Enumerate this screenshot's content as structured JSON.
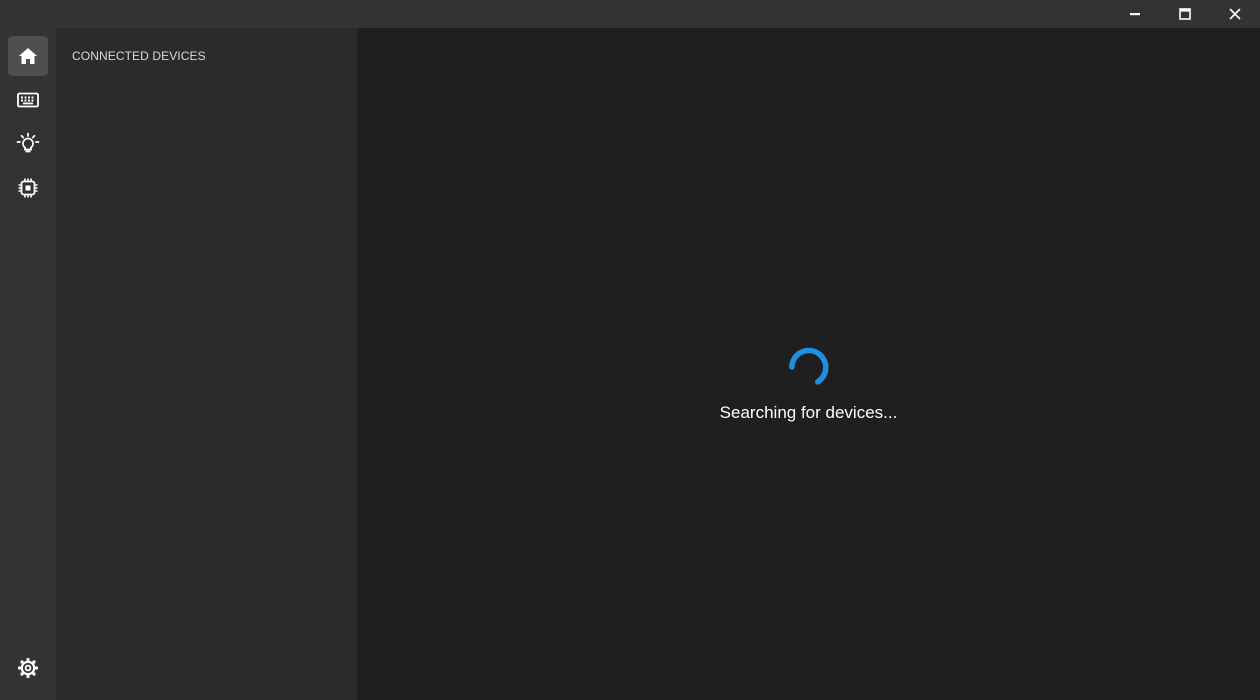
{
  "titlebar": {
    "controls": [
      {
        "name": "minimize",
        "icon": "minimize-icon"
      },
      {
        "name": "maximize",
        "icon": "maximize-icon"
      },
      {
        "name": "close",
        "icon": "close-icon"
      }
    ]
  },
  "rail": {
    "items": [
      {
        "id": "home",
        "icon": "home-icon",
        "active": true
      },
      {
        "id": "keyboard",
        "icon": "keyboard-icon",
        "active": false
      },
      {
        "id": "lighting",
        "icon": "lightbulb-icon",
        "active": false
      },
      {
        "id": "device",
        "icon": "chip-icon",
        "active": false
      }
    ],
    "settings": {
      "icon": "gear-icon"
    }
  },
  "side_panel": {
    "header": "CONNECTED DEVICES"
  },
  "main": {
    "status_text": "Searching for devices...",
    "spinner_color": "#1e8fe1"
  },
  "colors": {
    "titlebar_bg": "#333333",
    "rail_bg": "#333333",
    "rail_active_bg": "#4f4f4f",
    "side_panel_bg": "#2b2b2b",
    "content_bg": "#1f1f1f",
    "accent": "#1e8fe1"
  }
}
